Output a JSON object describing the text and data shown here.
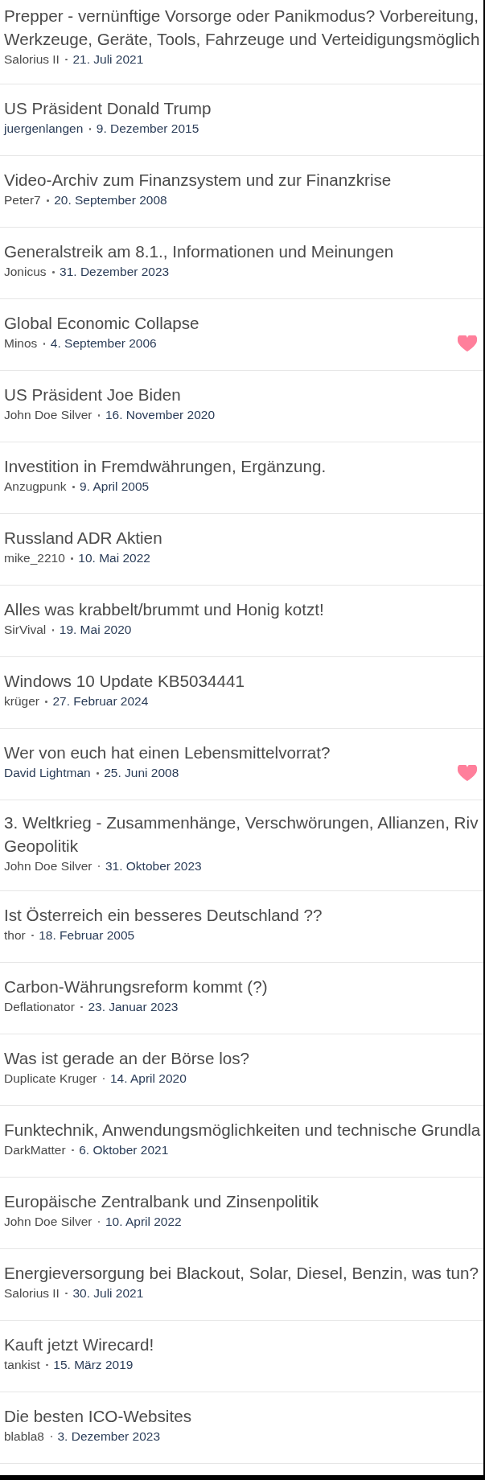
{
  "threads": [
    {
      "title": "Prepper - vernünftige Vorsorge oder Panikmodus? Vorbereitung,\nWerkzeuge, Geräte, Tools, Fahrzeuge und Verteidigungsmöglich",
      "author": {
        "name": "Salorius II",
        "color": "#4a4a4a"
      },
      "date": "21. Juli 2021",
      "liked": false
    },
    {
      "title": "US Präsident Donald Trump",
      "author": {
        "name": "juergenlangen",
        "color": "#2b3d58"
      },
      "date": "9. Dezember 2015",
      "liked": false
    },
    {
      "title": "Video-Archiv zum Finanzsystem und zur Finanzkrise",
      "author": {
        "name": "Peter7",
        "color": "#4a4a4a"
      },
      "date": "20. September 2008",
      "liked": false
    },
    {
      "title": "Generalstreik am 8.1., Informationen und Meinungen",
      "author": {
        "name": "Jonicus",
        "color": "#4a4a4a"
      },
      "date": "31. Dezember 2023",
      "liked": false
    },
    {
      "title": "Global Economic Collapse",
      "author": {
        "name": "Minos",
        "color": "#4a4a4a"
      },
      "date": "4. September 2006",
      "liked": true
    },
    {
      "title": "US Präsident Joe Biden",
      "author": {
        "name": "John Doe Silver",
        "color": "#4a4a4a"
      },
      "date": "16. November 2020",
      "liked": false
    },
    {
      "title": "Investition in Fremdwährungen, Ergänzung.",
      "author": {
        "name": "Anzugpunk",
        "color": "#4a4a4a"
      },
      "date": "9. April 2005",
      "liked": false
    },
    {
      "title": "Russland ADR Aktien",
      "author": {
        "name": "mike_2210",
        "color": "#4a4a4a"
      },
      "date": "10. Mai 2022",
      "liked": false
    },
    {
      "title": "Alles was krabbelt/brummt und Honig kotzt!",
      "author": {
        "name": "SirVival",
        "color": "#4a4a4a"
      },
      "date": "19. Mai 2020",
      "liked": false
    },
    {
      "title": "Windows 10 Update KB5034441",
      "author": {
        "name": "krüger",
        "color": "#4a4a4a"
      },
      "date": "27. Februar 2024",
      "liked": false
    },
    {
      "title": "Wer von euch hat einen Lebensmittelvorrat?",
      "author": {
        "name": "David Lightman",
        "color": "#2b3d58"
      },
      "date": "25. Juni 2008",
      "liked": true
    },
    {
      "title": "3. Weltkrieg - Zusammenhänge, Verschwörungen, Allianzen, Riv\nGeopolitik",
      "author": {
        "name": "John Doe Silver",
        "color": "#4a4a4a"
      },
      "date": "31. Oktober 2023",
      "liked": false
    },
    {
      "title": "Ist Österreich ein besseres Deutschland ??",
      "author": {
        "name": "thor",
        "color": "#4a4a4a"
      },
      "date": "18. Februar 2005",
      "liked": false
    },
    {
      "title": "Carbon-Währungsreform kommt (?)",
      "author": {
        "name": "Deflationator",
        "color": "#4a4a4a"
      },
      "date": "23. Januar 2023",
      "liked": false
    },
    {
      "title": "Was ist gerade an der Börse los?",
      "author": {
        "name": "Duplicate Kruger",
        "color": "#4a4a4a"
      },
      "date": "14. April 2020",
      "liked": false
    },
    {
      "title": "Funktechnik, Anwendungsmöglichkeiten und technische Grundla",
      "author": {
        "name": "DarkMatter",
        "color": "#4a4a4a"
      },
      "date": "6. Oktober 2021",
      "liked": false
    },
    {
      "title": "Europäische Zentralbank und Zinsenpolitik",
      "author": {
        "name": "John Doe Silver",
        "color": "#4a4a4a"
      },
      "date": "10. April 2022",
      "liked": false
    },
    {
      "title": "Energieversorgung bei Blackout, Solar, Diesel, Benzin, was tun?",
      "author": {
        "name": "Salorius II",
        "color": "#4a4a4a"
      },
      "date": "30. Juli 2021",
      "liked": false
    },
    {
      "title": "Kauft jetzt Wirecard!",
      "author": {
        "name": "tankist",
        "color": "#4a4a4a"
      },
      "date": "15. März 2019",
      "liked": false
    },
    {
      "title": "Die besten ICO-Websites",
      "author": {
        "name": "blabla8",
        "color": "#4a4a4a"
      },
      "date": "3. Dezember 2023",
      "liked": false
    }
  ]
}
